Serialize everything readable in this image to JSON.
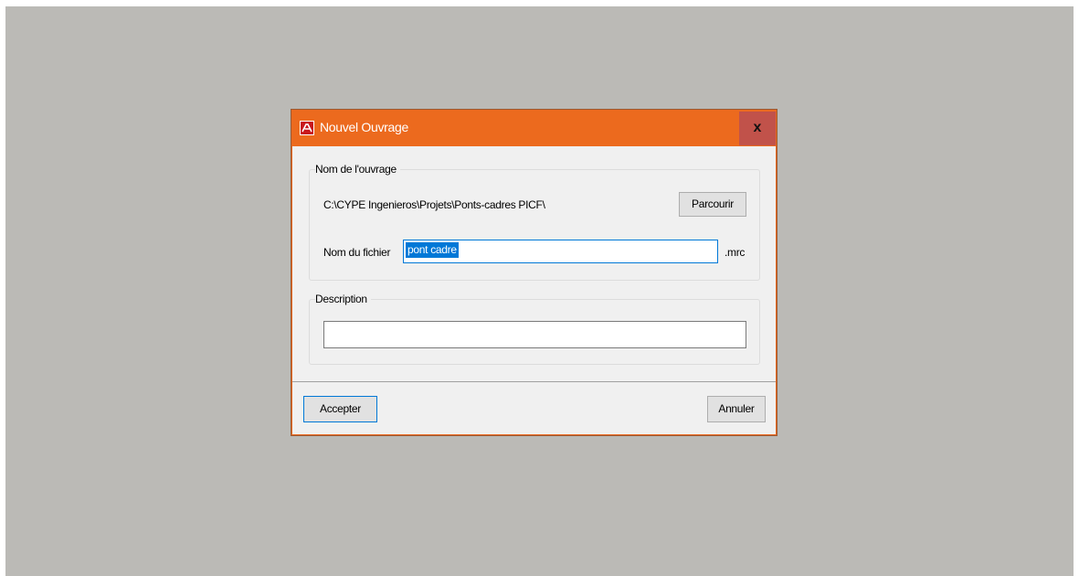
{
  "dialog": {
    "title": "Nouvel Ouvrage",
    "close_label": "x",
    "app_icon": "cype-logo-icon",
    "name_group": {
      "title": "Nom de l'ouvrage",
      "path": "C:\\CYPE Ingenieros\\Projets\\Ponts-cadres PICF\\",
      "browse_label": "Parcourir",
      "filename_label": "Nom du fichier",
      "filename_value": "pont cadre",
      "extension": ".mrc"
    },
    "description_group": {
      "title": "Description",
      "value": ""
    },
    "footer": {
      "accept_label": "Accepter",
      "cancel_label": "Annuler"
    }
  },
  "colors": {
    "titlebar": "#ec6a1e",
    "close_button": "#c1524a",
    "desktop": "#bbbab6",
    "selection": "#0078d7"
  }
}
